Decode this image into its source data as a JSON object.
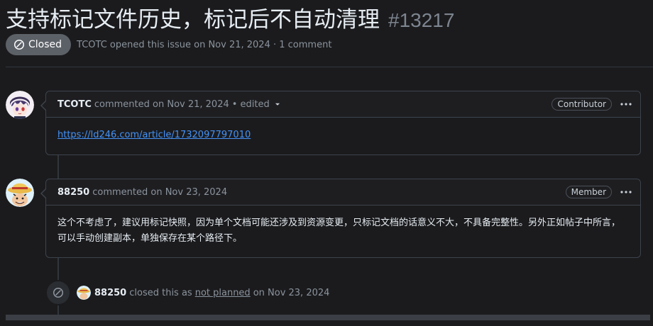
{
  "issue": {
    "title": "支持标记文件历史，标记后不自动清理",
    "number": "#13217",
    "state_label": "Closed",
    "author": "TCOTC",
    "meta_text": "opened this issue on Nov 21, 2024 · 1 comment"
  },
  "comments": [
    {
      "author": "TCOTC",
      "action": "commented on Nov 21, 2024",
      "edited": "• edited",
      "role": "Contributor",
      "body_link": "https://ld246.com/article/1732097797010"
    },
    {
      "author": "88250",
      "action": "commented on Nov 23, 2024",
      "role": "Member",
      "body_text": "这个不考虑了，建议用标记快照，因为单个文档可能还涉及到资源变更，只标记文档的话意义不大，不具备完整性。另外正如帖子中所言，可以手动创建副本，单独保存在某个路径下。"
    }
  ],
  "event": {
    "actor": "88250",
    "text_before": "closed this as",
    "reason": "not planned",
    "text_after": "on Nov 23, 2024"
  },
  "colors": {
    "background": "#1b1b1d",
    "closed_badge": "#5c6168",
    "link": "#4493f8",
    "border": "#3d444d"
  },
  "icons": {
    "state": "skip-circle-icon",
    "caret": "triangle-down-icon",
    "menu": "kebab-horizontal-icon"
  }
}
